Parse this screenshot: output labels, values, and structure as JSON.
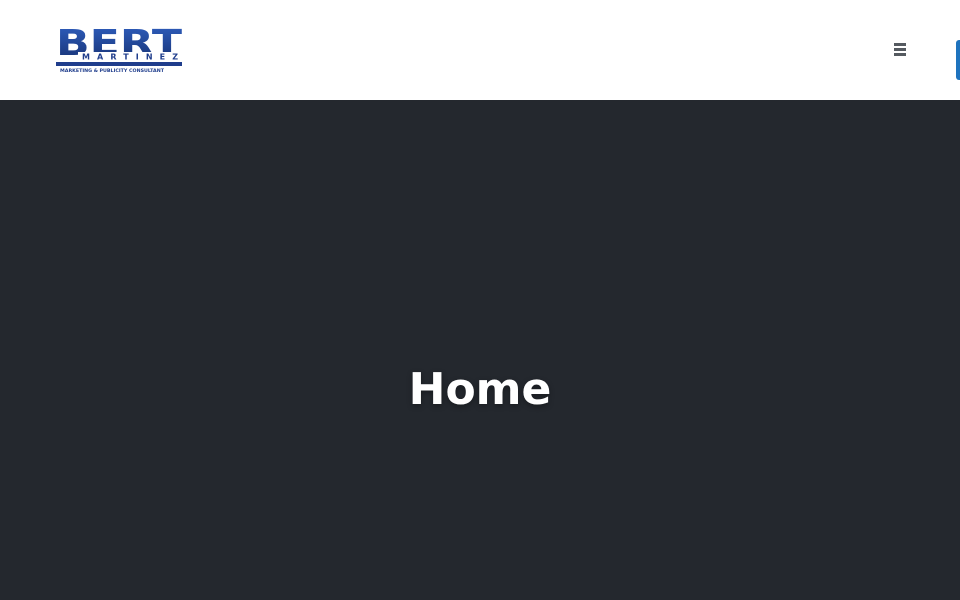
{
  "header": {
    "logo": {
      "main_text": "BERT",
      "sub_text": "MARTINEZ",
      "tagline": "MARKETING & PUBLICITY CONSULTANT",
      "primary_color": "#1f3d8c",
      "accent_color": "#2f5fc0"
    },
    "menu_icon": "hamburger-menu-icon"
  },
  "hero": {
    "title": "Home",
    "background_color": "#24282e"
  }
}
